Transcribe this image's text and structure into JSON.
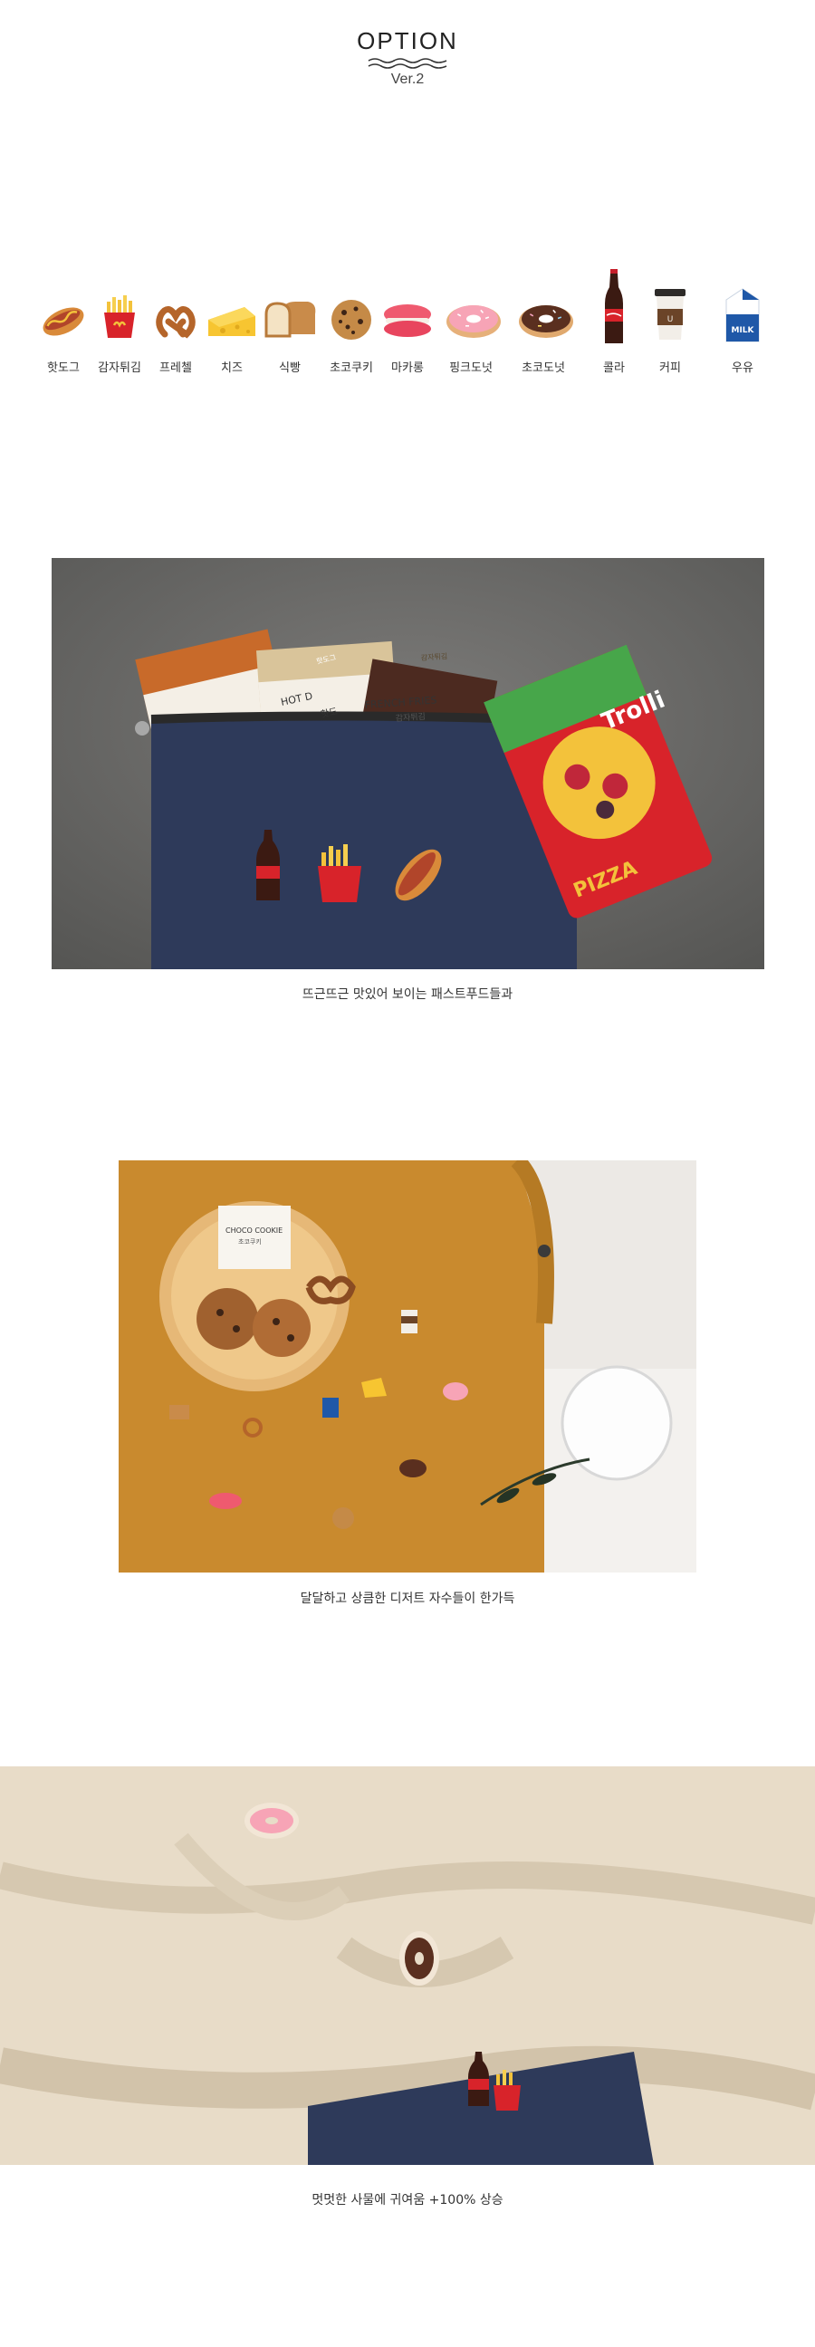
{
  "header": {
    "title": "OPTION",
    "version": "Ver.2"
  },
  "options": [
    {
      "label": "핫도그",
      "icon": "hotdog-icon"
    },
    {
      "label": "감자튀김",
      "icon": "french-fries-icon"
    },
    {
      "label": "프레첼",
      "icon": "pretzel-icon"
    },
    {
      "label": "치즈",
      "icon": "cheese-icon"
    },
    {
      "label": "식빵",
      "icon": "bread-icon"
    },
    {
      "label": "초코쿠키",
      "icon": "choco-cookie-icon"
    },
    {
      "label": "마카롱",
      "icon": "macaron-icon"
    },
    {
      "label": "핑크도넛",
      "icon": "pink-donut-icon"
    },
    {
      "label": "초코도넛",
      "icon": "choco-donut-icon"
    },
    {
      "label": "콜라",
      "icon": "cola-icon"
    },
    {
      "label": "커피",
      "icon": "coffee-icon"
    },
    {
      "label": "우유",
      "icon": "milk-icon"
    }
  ],
  "photo1": {
    "card_fries_title": "FRENCH FRIES",
    "card_fries_sub": "감자튀김",
    "card_hotdog_title": "HOT D",
    "card_hotdog_sub": "핫도",
    "card_tag_left": "핫도그",
    "card_tag_mid": "감자튀김",
    "candy_brand": "Trolli",
    "candy_name": "PIZZA",
    "caption": "뜨근뜨근 맛있어 보이는 패스트푸드들과"
  },
  "photo2": {
    "card_title": "CHOCO COOKIE",
    "card_sub": "초코쿠키",
    "caption": "달달하고 상큼한 디저트 자수들이 한가득"
  },
  "photo3": {
    "caption": "멋멋한 사물에 귀여움 +100% 상승"
  },
  "colors": {
    "denim": "#2e3a5a",
    "corduroy": "#c98a2e",
    "sweatshirt": "#e8dcc8",
    "concrete": "#6b6b6b"
  }
}
